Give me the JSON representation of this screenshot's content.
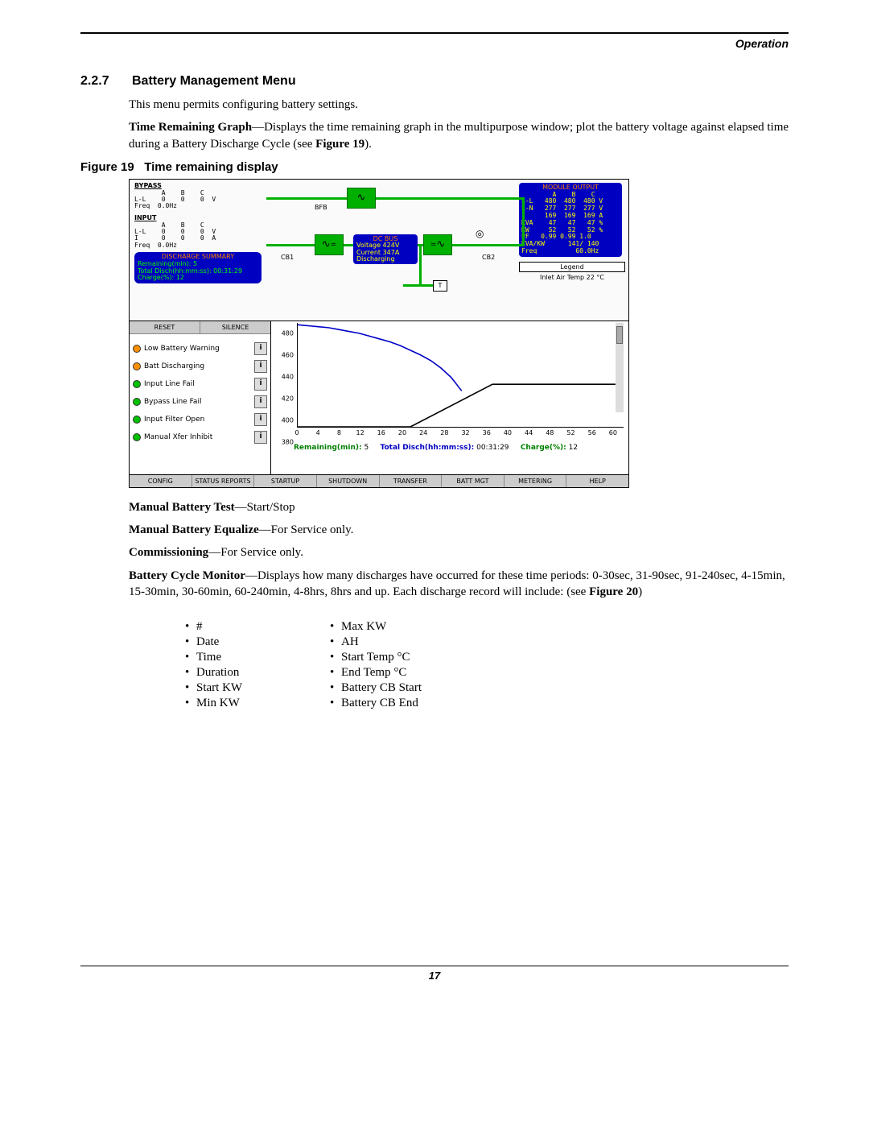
{
  "header": {
    "chapter": "Operation"
  },
  "section": {
    "number": "2.2.7",
    "title": "Battery Management Menu"
  },
  "paragraphs": {
    "intro": "This menu permits configuring battery settings.",
    "timeGraph_label": "Time Remaining Graph",
    "timeGraph_text": "—Displays the time remaining graph in the multipurpose window; plot the battery voltage against elapsed time during a Battery Discharge Cycle (see ",
    "timeGraph_ref": "Figure 19",
    "timeGraph_end": ").",
    "manualTest_label": "Manual Battery Test",
    "manualTest_text": "—Start/Stop",
    "equalize_label": "Manual Battery Equalize",
    "equalize_text": "—For Service only.",
    "commissioning_label": "Commissioning",
    "commissioning_text": "—For Service only.",
    "cycleMon_label": "Battery Cycle Monitor",
    "cycleMon_text": "—Displays how many discharges have occurred for these time periods: 0-30sec, 31-90sec, 91-240sec, 4-15min, 15-30min, 30-60min, 60-240min, 4-8hrs, 8hrs and up. Each discharge record will include: (see ",
    "cycleMon_ref": "Figure 20",
    "cycleMon_end": ")"
  },
  "figure": {
    "label": "Figure 19",
    "title": "Time remaining display"
  },
  "ups": {
    "bypass": {
      "title": "BYPASS",
      "head": "       A    B    C",
      "ll": "L-L    0    0    0  V",
      "freq": "Freq  0.0Hz"
    },
    "input": {
      "title": "INPUT",
      "head": "       A    B    C",
      "ll": "L-L    0    0    0  V",
      "i": "I      0    0    0  A",
      "freq": "Freq  0.0Hz"
    },
    "discharge": {
      "title": "DISCHARGE SUMMARY",
      "row1": "Remaining(min):           5",
      "row2": "Total Disch(hh:mm:ss): 00:31:29",
      "row3": "Charge(%):               12"
    },
    "labels": {
      "bfb": "BFB",
      "cb1": "CB1",
      "cb2": "CB2",
      "t": "T",
      "knob": "◎"
    },
    "dcbus": {
      "title": "DC BUS",
      "voltage": "Voltage   424V",
      "current": "Current   347A",
      "state": "Discharging"
    },
    "moduleOutput": {
      "title": "MODULE OUTPUT",
      "head": "        A    B    C",
      "ll": "L-L   480  480  480 V",
      "ln": "L-N   277  277  277 V",
      "i": "I     169  169  169 A",
      "kva": "KVA    47   47   47 %",
      "kw": "KW     52   52   52 %",
      "pf": "PF   0.99 0.99 1.0",
      "kvakw": "KVA/KW      141/ 140",
      "freq": "Freq          60.0Hz"
    },
    "legend": "Legend",
    "inlet": "Inlet Air Temp 22 °C",
    "buttons": {
      "reset": "RESET",
      "silence": "SILENCE"
    },
    "alarms": [
      {
        "color": "orange",
        "label": "Low Battery Warning"
      },
      {
        "color": "orange",
        "label": "Batt Discharging"
      },
      {
        "color": "green",
        "label": "Input Line Fail"
      },
      {
        "color": "green",
        "label": "Bypass Line Fail"
      },
      {
        "color": "green",
        "label": "Input Filter Open"
      },
      {
        "color": "green",
        "label": "Manual Xfer Inhibit"
      }
    ],
    "info_i": "i",
    "chartFooter": {
      "remaining_label": "Remaining(min):",
      "remaining_val": "5",
      "total_label": "Total Disch(hh:mm:ss):",
      "total_val": "00:31:29",
      "charge_label": "Charge(%):",
      "charge_val": "12"
    },
    "menubar": [
      "CONFIG",
      "STATUS REPORTS",
      "STARTUP",
      "SHUTDOWN",
      "TRANSFER",
      "BATT MGT",
      "METERING",
      "HELP"
    ]
  },
  "chart_data": {
    "type": "line",
    "title": "",
    "xlabel": "",
    "ylabel": "",
    "xlim": [
      0,
      62
    ],
    "ylim": [
      380,
      490
    ],
    "x_ticks": [
      0,
      4,
      8,
      12,
      16,
      20,
      24,
      28,
      32,
      36,
      40,
      44,
      48,
      52,
      56,
      60
    ],
    "y_ticks": [
      380,
      400,
      420,
      440,
      460,
      480
    ],
    "series": [
      {
        "name": "voltage",
        "color": "#0000c8",
        "x": [
          0,
          2,
          4,
          6,
          8,
          10,
          12,
          14,
          16,
          18,
          20,
          22,
          24,
          26,
          28,
          30,
          32
        ],
        "y": [
          488,
          487,
          486,
          485,
          483,
          481,
          479,
          476,
          473,
          470,
          466,
          461,
          456,
          450,
          442,
          432,
          418
        ]
      },
      {
        "name": "baseline",
        "color": "#000000",
        "x": [
          0,
          22,
          38,
          62
        ],
        "y": [
          380,
          380,
          425,
          425
        ]
      }
    ]
  },
  "recordFields": {
    "col1": [
      "#",
      "Date",
      "Time",
      "Duration",
      "Start KW",
      "Min KW"
    ],
    "col2": [
      "Max KW",
      "AH",
      "Start Temp °C",
      "End Temp °C",
      "Battery CB Start",
      "Battery CB End"
    ]
  },
  "pageNumber": "17"
}
